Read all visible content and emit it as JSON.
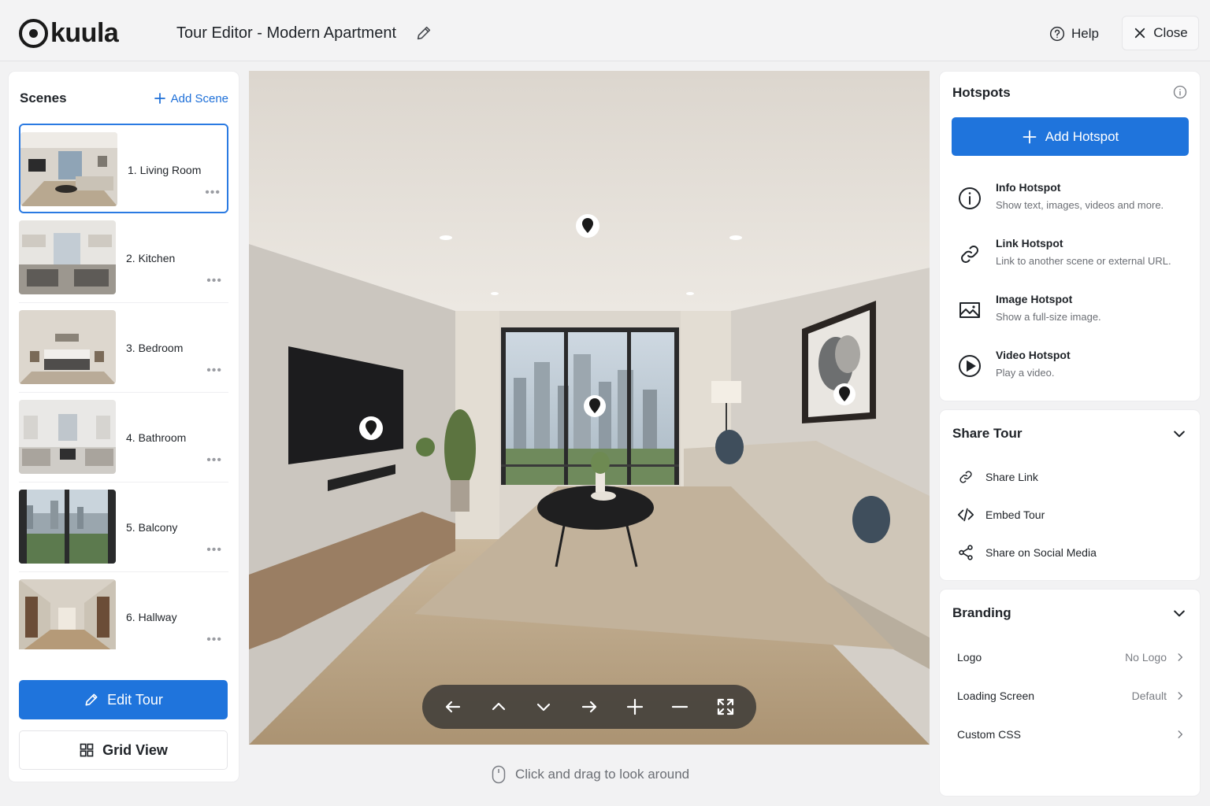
{
  "app": {
    "logo_text": "kuula",
    "tour_title": "Tour Editor - Modern Apartment"
  },
  "header": {
    "help_label": "Help",
    "close_label": "Close"
  },
  "scenes": {
    "title": "Scenes",
    "add_label": "Add Scene",
    "items": [
      {
        "label": "1. Living Room"
      },
      {
        "label": "2. Kitchen"
      },
      {
        "label": "3. Bedroom"
      },
      {
        "label": "4. Bathroom"
      },
      {
        "label": "5. Balcony"
      },
      {
        "label": "6. Hallway"
      }
    ],
    "edit_tour_label": "Edit Tour",
    "grid_view_label": "Grid View"
  },
  "viewer": {
    "hint": "Click and drag to look around"
  },
  "hotspots": {
    "title": "Hotspots",
    "add_label": "Add Hotspot",
    "items": [
      {
        "title": "Info Hotspot",
        "desc": "Show text, images, videos and more."
      },
      {
        "title": "Link Hotspot",
        "desc": "Link to another scene or external URL."
      },
      {
        "title": "Image Hotspot",
        "desc": "Show a full-size image."
      },
      {
        "title": "Video Hotspot",
        "desc": "Play a video."
      }
    ]
  },
  "share": {
    "title": "Share Tour",
    "items": [
      {
        "label": "Share Link"
      },
      {
        "label": "Embed Tour"
      },
      {
        "label": "Share on Social Media"
      }
    ]
  },
  "branding": {
    "title": "Branding",
    "rows": [
      {
        "label": "Logo",
        "value": "No Logo"
      },
      {
        "label": "Loading Screen",
        "value": "Default"
      },
      {
        "label": "Custom CSS",
        "value": ""
      }
    ]
  },
  "colors": {
    "accent": "#1f74dc",
    "active_border": "#2a7ae2"
  }
}
